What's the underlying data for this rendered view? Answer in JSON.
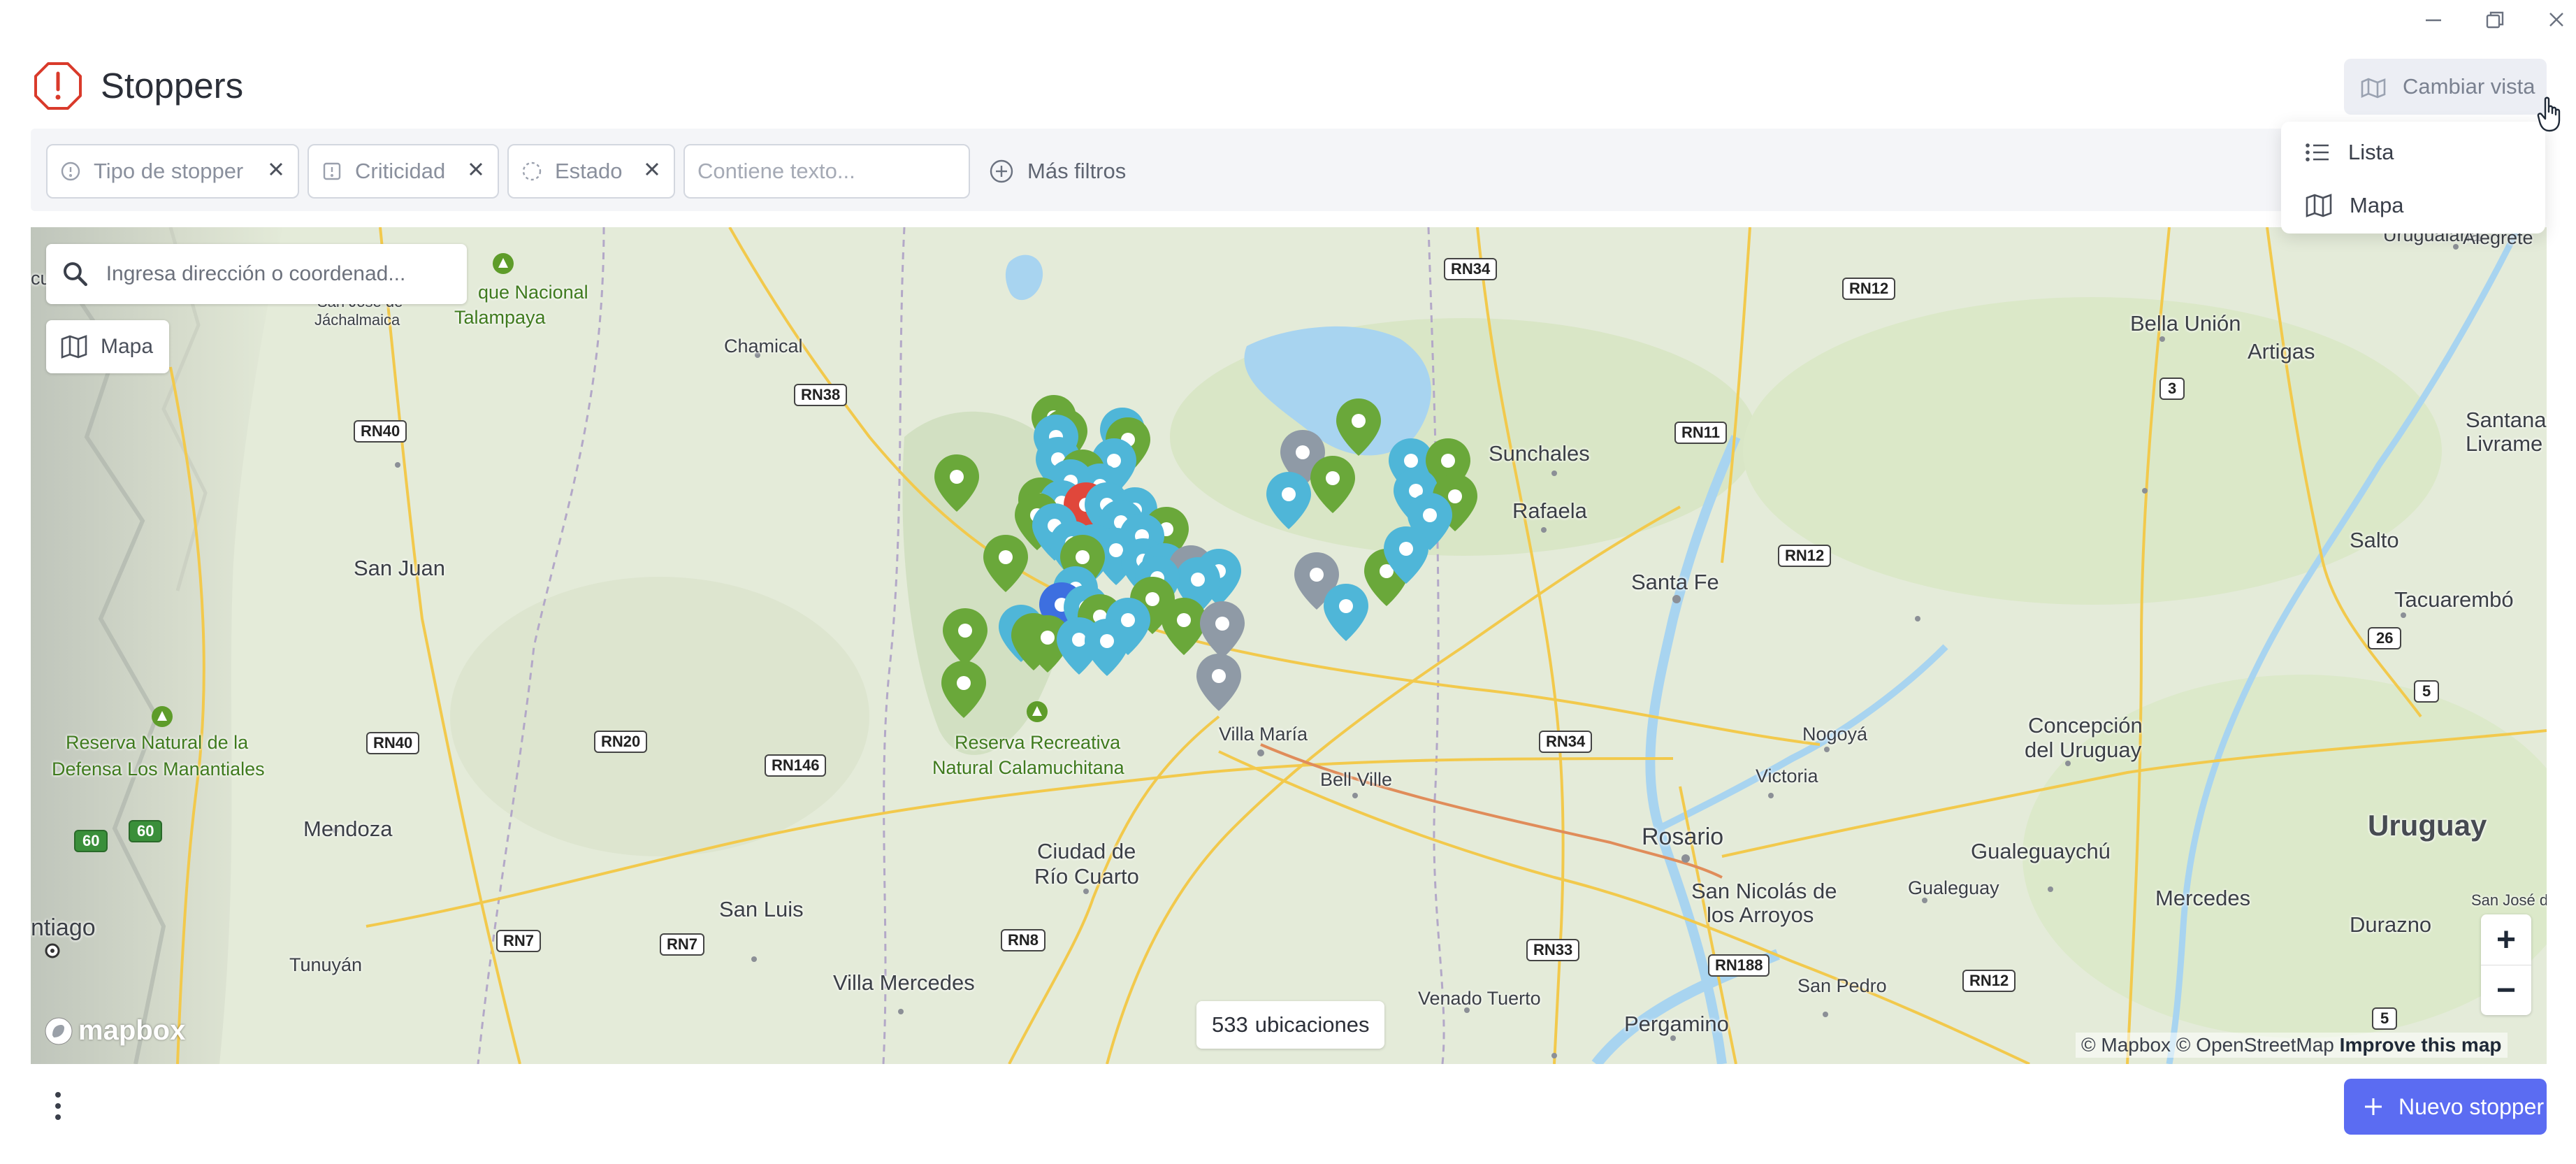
{
  "window": {
    "minimize": "minimize",
    "restore": "restore",
    "close": "close"
  },
  "header": {
    "title": "Stoppers",
    "view_button": "Cambiar vista"
  },
  "filters": {
    "chips": [
      {
        "label": "Tipo de stopper",
        "icon": "info-circle-icon"
      },
      {
        "label": "Criticidad",
        "icon": "alert-square-icon"
      },
      {
        "label": "Estado",
        "icon": "dashed-circle-icon"
      }
    ],
    "text_placeholder": "Contiene texto...",
    "more": "Más filtros"
  },
  "view_menu": {
    "items": [
      {
        "label": "Lista",
        "icon": "list-icon"
      },
      {
        "label": "Mapa",
        "icon": "map-icon"
      }
    ]
  },
  "map": {
    "search_placeholder": "Ingresa dirección o coordenad...",
    "style_button": "Mapa",
    "count_number": "533",
    "count_label": "ubicaciones",
    "attribution_text": "© Mapbox © OpenStreetMap",
    "attribution_link": "Improve this map",
    "logo": "mapbox",
    "zoom_in": "+",
    "zoom_out": "−",
    "labels": {
      "parque_nacional": "que Nacional",
      "talampaya": "Talampaya",
      "san_jose": "San José de",
      "jachal": "Jáchalmaica",
      "chamical": "Chamical",
      "san_juan": "San Juan",
      "reserva_manantiales_1": "Reserva Natural de la",
      "reserva_manantiales_2": "Defensa Los Manantiales",
      "mendoza": "Mendoza",
      "tunuyan": "Tunuyán",
      "santiago": "ntiago",
      "cu": "cu",
      "san_luis": "San Luis",
      "villa_mercedes": "Villa Mercedes",
      "reserva_calamu_1": "Reserva Recreativa",
      "reserva_calamu_2": "Natural Calamuchitana",
      "rio_cuarto_1": "Ciudad de",
      "rio_cuarto_2": "Río Cuarto",
      "villa_maria": "Villa María",
      "bell_ville": "Bell Ville",
      "venado": "Venado Tuerto",
      "pergamino": "Pergamino",
      "rosario": "Rosario",
      "san_nicolas_1": "San Nicolás de",
      "san_nicolas_2": "los Arroyos",
      "san_pedro": "San Pedro",
      "victoria": "Victoria",
      "nogoya": "Nogoyá",
      "santa_fe": "Santa Fe",
      "rafaela": "Rafaela",
      "sunchales": "Sunchales",
      "concepcion_1": "Concepción",
      "concepcion_2": "del Uruguay",
      "gualeguaychu": "Gualeguaychú",
      "gualeguay": "Gualeguay",
      "mercedes": "Mercedes",
      "durazno": "Durazno",
      "uruguay": "Uruguay",
      "salto": "Salto",
      "tacuarembo": "Tacuarembó",
      "bella_union": "Bella Unión",
      "artigas": "Artigas",
      "santana_1": "Santana",
      "santana_2": "Livrame",
      "uruguaiana": "Uruguaiana",
      "alegrete": "Alegrete",
      "san_jose_uy": "San José de"
    },
    "roads": {
      "rn34": "RN34",
      "rn12a": "RN12",
      "rn11": "RN11",
      "rn38": "RN38",
      "rn40a": "RN40",
      "rn12b": "RN12",
      "rn40b": "RN40",
      "rn20": "RN20",
      "rn146": "RN146",
      "rn34b": "RN34",
      "rn7a": "RN7",
      "rn7b": "RN7",
      "rn8": "RN8",
      "rn33": "RN33",
      "rn188": "RN188",
      "rn12c": "RN12",
      "r60a": "60",
      "r60b": "60",
      "r3": "3",
      "r26": "26",
      "r5a": "5",
      "r5b": "5"
    }
  },
  "footer": {
    "new_button": "Nuevo stopper"
  },
  "colors": {
    "accent": "#5b6cf2",
    "alert": "#d93a2b",
    "pin_green": "#6aa83a",
    "pin_blue": "#4fb6d8",
    "pin_gray": "#8f9aa6",
    "pin_red": "#e0473b",
    "water": "#a8d4f0"
  }
}
